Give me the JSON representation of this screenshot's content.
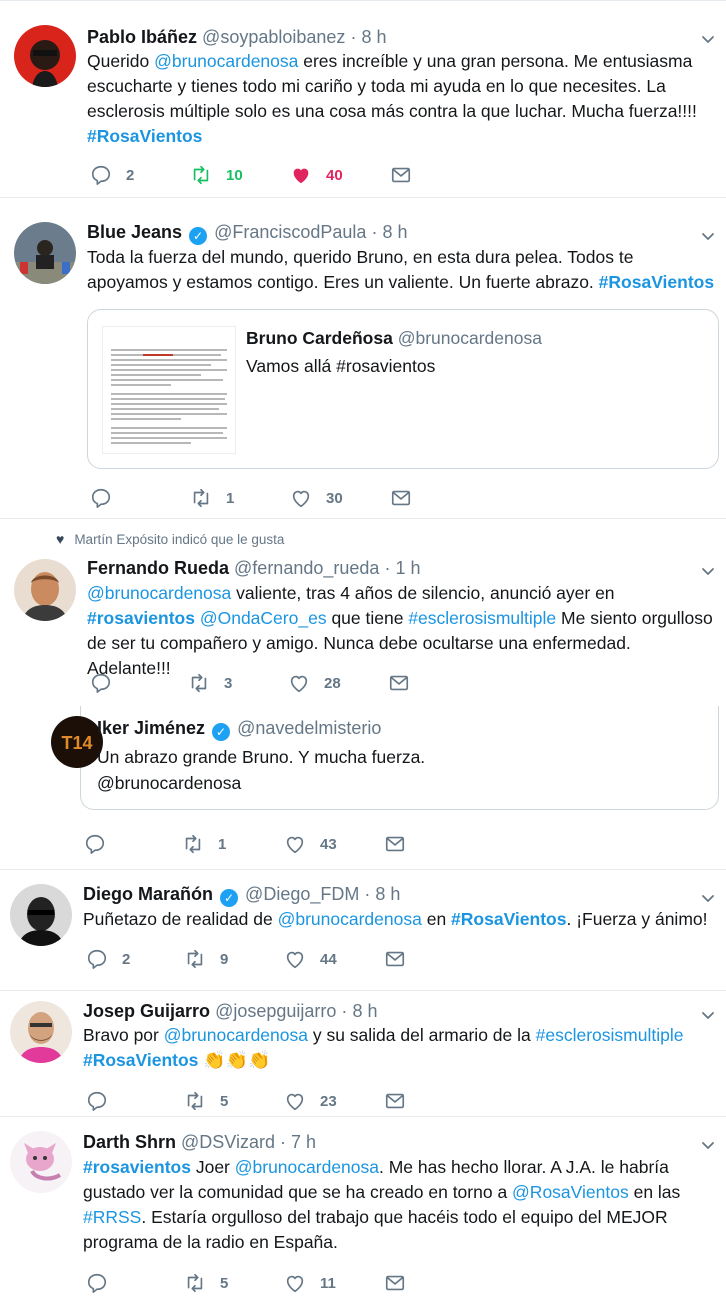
{
  "tweets": {
    "t1": {
      "name": "Pablo Ibáñez",
      "handle": "@soypabloibanez",
      "dot": "·",
      "time": "8 h",
      "body": {
        "pre": "Querido ",
        "mention": "@brunocardenosa",
        "post": " eres increíble y una gran persona. Me entusiasma escucharte y tienes todo mi cariño y toda mi ayuda en lo que necesites. La esclerosis múltiple solo es una cosa más contra la que luchar. Mucha fuerza!!!!",
        "hashtag": "#RosaVientos"
      },
      "replies": "2",
      "retweets": "10",
      "likes": "40"
    },
    "t2": {
      "name": "Blue Jeans",
      "handle": "@FranciscodPaula",
      "dot": "·",
      "time": "8 h",
      "body": {
        "text": "Toda la fuerza del mundo, querido Bruno, en esta dura pelea. Todos te apoyamos y estamos contigo. Eres un valiente. Un fuerte abrazo. ",
        "hashtag": "#RosaVientos"
      },
      "quote": {
        "name": "Bruno Cardeñosa",
        "handle": "@brunocardenosa",
        "text": "Vamos allá #rosavientos"
      },
      "replies": "",
      "retweets": "1",
      "likes": "30"
    },
    "t3": {
      "social_context": "Martín Expósito indicó que le gusta",
      "name": "Fernando Rueda",
      "handle": "@fernando_rueda",
      "dot": "·",
      "time": "1 h",
      "body": {
        "mention1": "@brunocardenosa",
        "text1": " valiente, tras 4 años de silencio, anunció ayer en ",
        "hashtag1": "#rosavientos",
        "mention2": "@OndaCero_es",
        "text2": " que tiene ",
        "hashtag2": "#esclerosismultiple",
        "text3": " Me siento orgulloso de ser tu compañero y amigo. Nunca debe ocultarse una enfermedad. Adelante!!!"
      },
      "replies": "",
      "retweets": "3",
      "likes": "28"
    },
    "t4": {
      "name": "Iker Jiménez",
      "handle": "@navedelmisterio",
      "body": {
        "line1": "Un abrazo grande Bruno. Y mucha fuerza.",
        "line2": "@brunocardenosa"
      },
      "avatar_text": "T14",
      "replies": "",
      "retweets": "1",
      "likes": "43"
    },
    "t5": {
      "name": "Diego Marañón",
      "handle": "@Diego_FDM",
      "dot": "·",
      "time": "8 h",
      "body": {
        "pre": "Puñetazo de realidad de ",
        "mention": "@brunocardenosa",
        "mid": " en ",
        "hashtag": "#RosaVientos",
        "post": ". ¡Fuerza y ánimo!"
      },
      "replies": "2",
      "retweets": "9",
      "likes": "44"
    },
    "t6": {
      "name": "Josep Guijarro",
      "handle": "@josepguijarro",
      "dot": "·",
      "time": "8 h",
      "body": {
        "pre": "Bravo por ",
        "mention": "@brunocardenosa",
        "mid": " y su salida del armario de la ",
        "hashtag1": "#esclerosismultiple",
        "hashtag2": "#RosaVientos",
        "emoji": "👏👏👏"
      },
      "replies": "",
      "retweets": "5",
      "likes": "23"
    },
    "t7": {
      "name": "Darth Shrn",
      "handle": "@DSVizard",
      "dot": "·",
      "time": "7 h",
      "body": {
        "hashtag1": "#rosavientos",
        "t1": " Joer ",
        "mention1": "@brunocardenosa",
        "t2": ". Me has hecho llorar. A J.A. le habría gustado ver la comunidad que se ha creado en torno a ",
        "mention2": "@RosaVientos",
        "t3": " en las ",
        "hashtag2": "#RRSS",
        "t4": ". Estaría orgulloso del trabajo que hacéis todo el equipo del MEJOR programa de la radio en España."
      },
      "replies": "",
      "retweets": "5",
      "likes": "11"
    }
  },
  "icons": {
    "reply": "reply-icon",
    "retweet": "retweet-icon",
    "like": "heart-icon",
    "dm": "envelope-icon",
    "more": "chevron-down-icon",
    "verified": "verified-badge-icon"
  },
  "colors": {
    "link": "#1b95e0",
    "retweet_active": "#17bf63",
    "like_active": "#e0245e",
    "muted": "#657786",
    "border": "#e6ecf0"
  }
}
